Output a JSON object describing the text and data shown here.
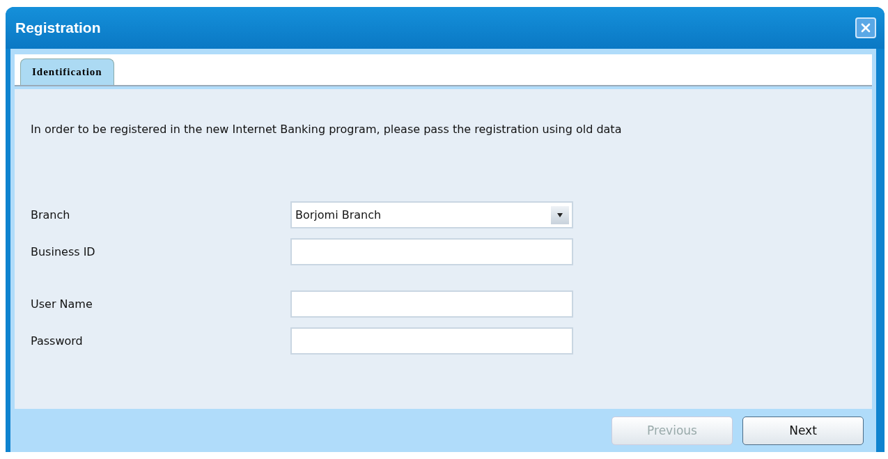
{
  "window": {
    "title": "Registration"
  },
  "tabs": [
    {
      "label": "Identification",
      "selected": true
    }
  ],
  "intro": "In order to be registered in the new Internet Banking program, please pass the registration using old data",
  "fields": [
    {
      "label": "Branch",
      "kind": "select",
      "value": "Borjomi Branch"
    },
    {
      "label": "Business ID",
      "kind": "text"
    },
    {
      "label": "User Name",
      "kind": "text",
      "gap": true
    },
    {
      "label": "Password",
      "kind": "password"
    }
  ],
  "buttons": [
    {
      "label": "Previous",
      "disabled": true
    },
    {
      "label": "Next",
      "disabled": false
    }
  ]
}
